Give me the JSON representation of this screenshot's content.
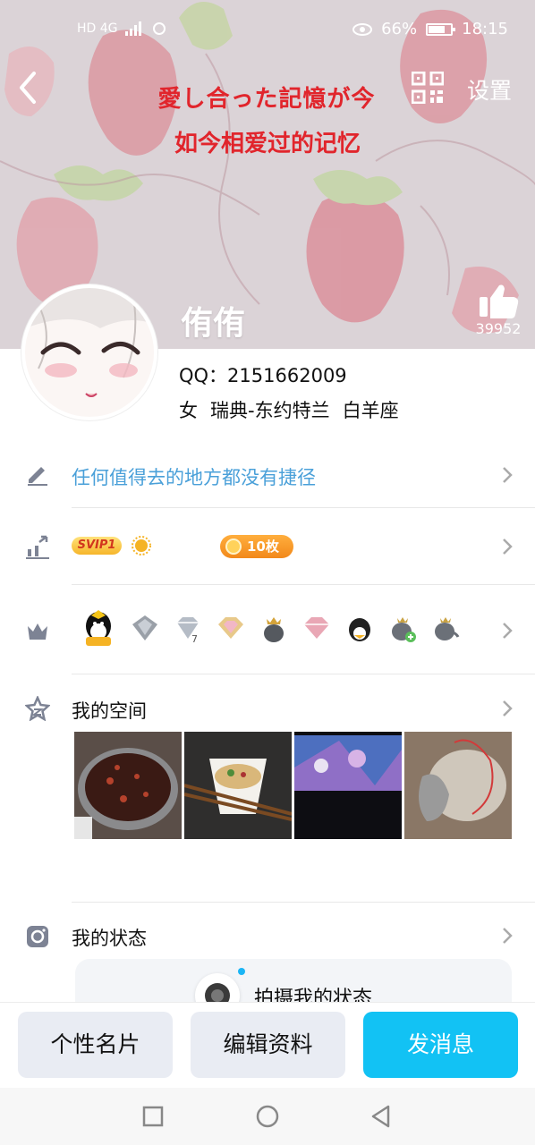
{
  "status_bar": {
    "network": "HD 4G",
    "battery_percent": "66%",
    "time": "18:15"
  },
  "header": {
    "back_icon": "chevron-left-icon",
    "qr_icon": "qr-code-icon",
    "settings_label": "设置",
    "signature_line1": "愛し合った記憶が今",
    "signature_line2": "如今相爱过的记忆"
  },
  "profile": {
    "nickname": "侑侑",
    "qq_label": "QQ：2151662009",
    "gender": "女",
    "location": "瑞典-东约特兰",
    "zodiac": "白羊座",
    "likes": "39952"
  },
  "rows": {
    "signature": "任何值得去的地方都没有捷径",
    "svip_label": "SVIP1",
    "coins_label": "10枚",
    "space_title": "我的空间",
    "status_title": "我的状态",
    "status_prompt": "拍摄我的状态"
  },
  "actions": {
    "card": "个性名片",
    "edit": "编辑资料",
    "message": "发消息"
  },
  "colors": {
    "accent": "#12c2f4",
    "signature_red": "#e1252c",
    "link_blue": "#4aa0d9"
  }
}
